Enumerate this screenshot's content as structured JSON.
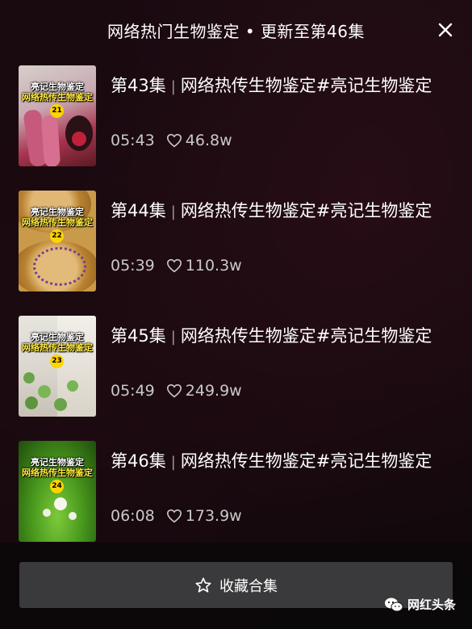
{
  "header": {
    "title": "网络热门生物鉴定 • 更新至第46集"
  },
  "episodes": [
    {
      "ep": "第43集",
      "title": "网络热传生物鉴定#亮记生物鉴定",
      "duration": "05:43",
      "likes": "46.8w",
      "thumb": {
        "line1": "亮记生物鉴定",
        "line2": "网络热传生物鉴定",
        "num": "21"
      }
    },
    {
      "ep": "第44集",
      "title": "网络热传生物鉴定#亮记生物鉴定",
      "duration": "05:39",
      "likes": "110.3w",
      "thumb": {
        "line1": "亮记生物鉴定",
        "line2": "网络热传生物鉴定",
        "num": "22"
      }
    },
    {
      "ep": "第45集",
      "title": "网络热传生物鉴定#亮记生物鉴定",
      "duration": "05:49",
      "likes": "249.9w",
      "thumb": {
        "line1": "亮记生物鉴定",
        "line2": "网络热传生物鉴定",
        "num": "23"
      }
    },
    {
      "ep": "第46集",
      "title": "网络热传生物鉴定#亮记生物鉴定",
      "duration": "06:08",
      "likes": "173.9w",
      "thumb": {
        "line1": "亮记生物鉴定",
        "line2": "网络热传生物鉴定",
        "num": "24"
      }
    }
  ],
  "footer": {
    "collect_label": "收藏合集"
  },
  "watermark": {
    "text": "网红头条"
  },
  "icons": {
    "close": "close-icon",
    "heart": "heart-icon",
    "star": "star-icon",
    "wechat": "wechat-icon"
  }
}
